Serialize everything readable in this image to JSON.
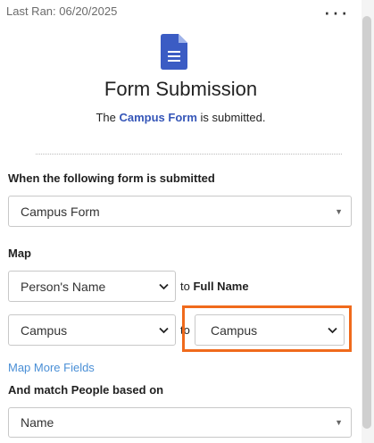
{
  "header": {
    "last_ran": "Last Ran: 06/20/2025",
    "menu_icon": "more-dots-icon"
  },
  "summary": {
    "icon": "document-icon",
    "icon_color": "#3b5cc4",
    "title": "Form Submission",
    "subtitle_prefix": "The ",
    "form_name": "Campus Form",
    "subtitle_suffix": " is submitted."
  },
  "trigger": {
    "label": "When the following form is submitted",
    "selected_form": "Campus Form"
  },
  "map": {
    "label": "Map",
    "rows": [
      {
        "source": "Person's Name",
        "to": "to",
        "target_text": "Full Name"
      },
      {
        "source": "Campus",
        "to": "to",
        "target_select": "Campus"
      }
    ],
    "more_fields_link": "Map More Fields"
  },
  "match": {
    "label": "And match People based on",
    "selected": "Name"
  },
  "colors": {
    "accent": "#3556b8",
    "link": "#4a8fd6",
    "highlight": "#f06a1c"
  }
}
